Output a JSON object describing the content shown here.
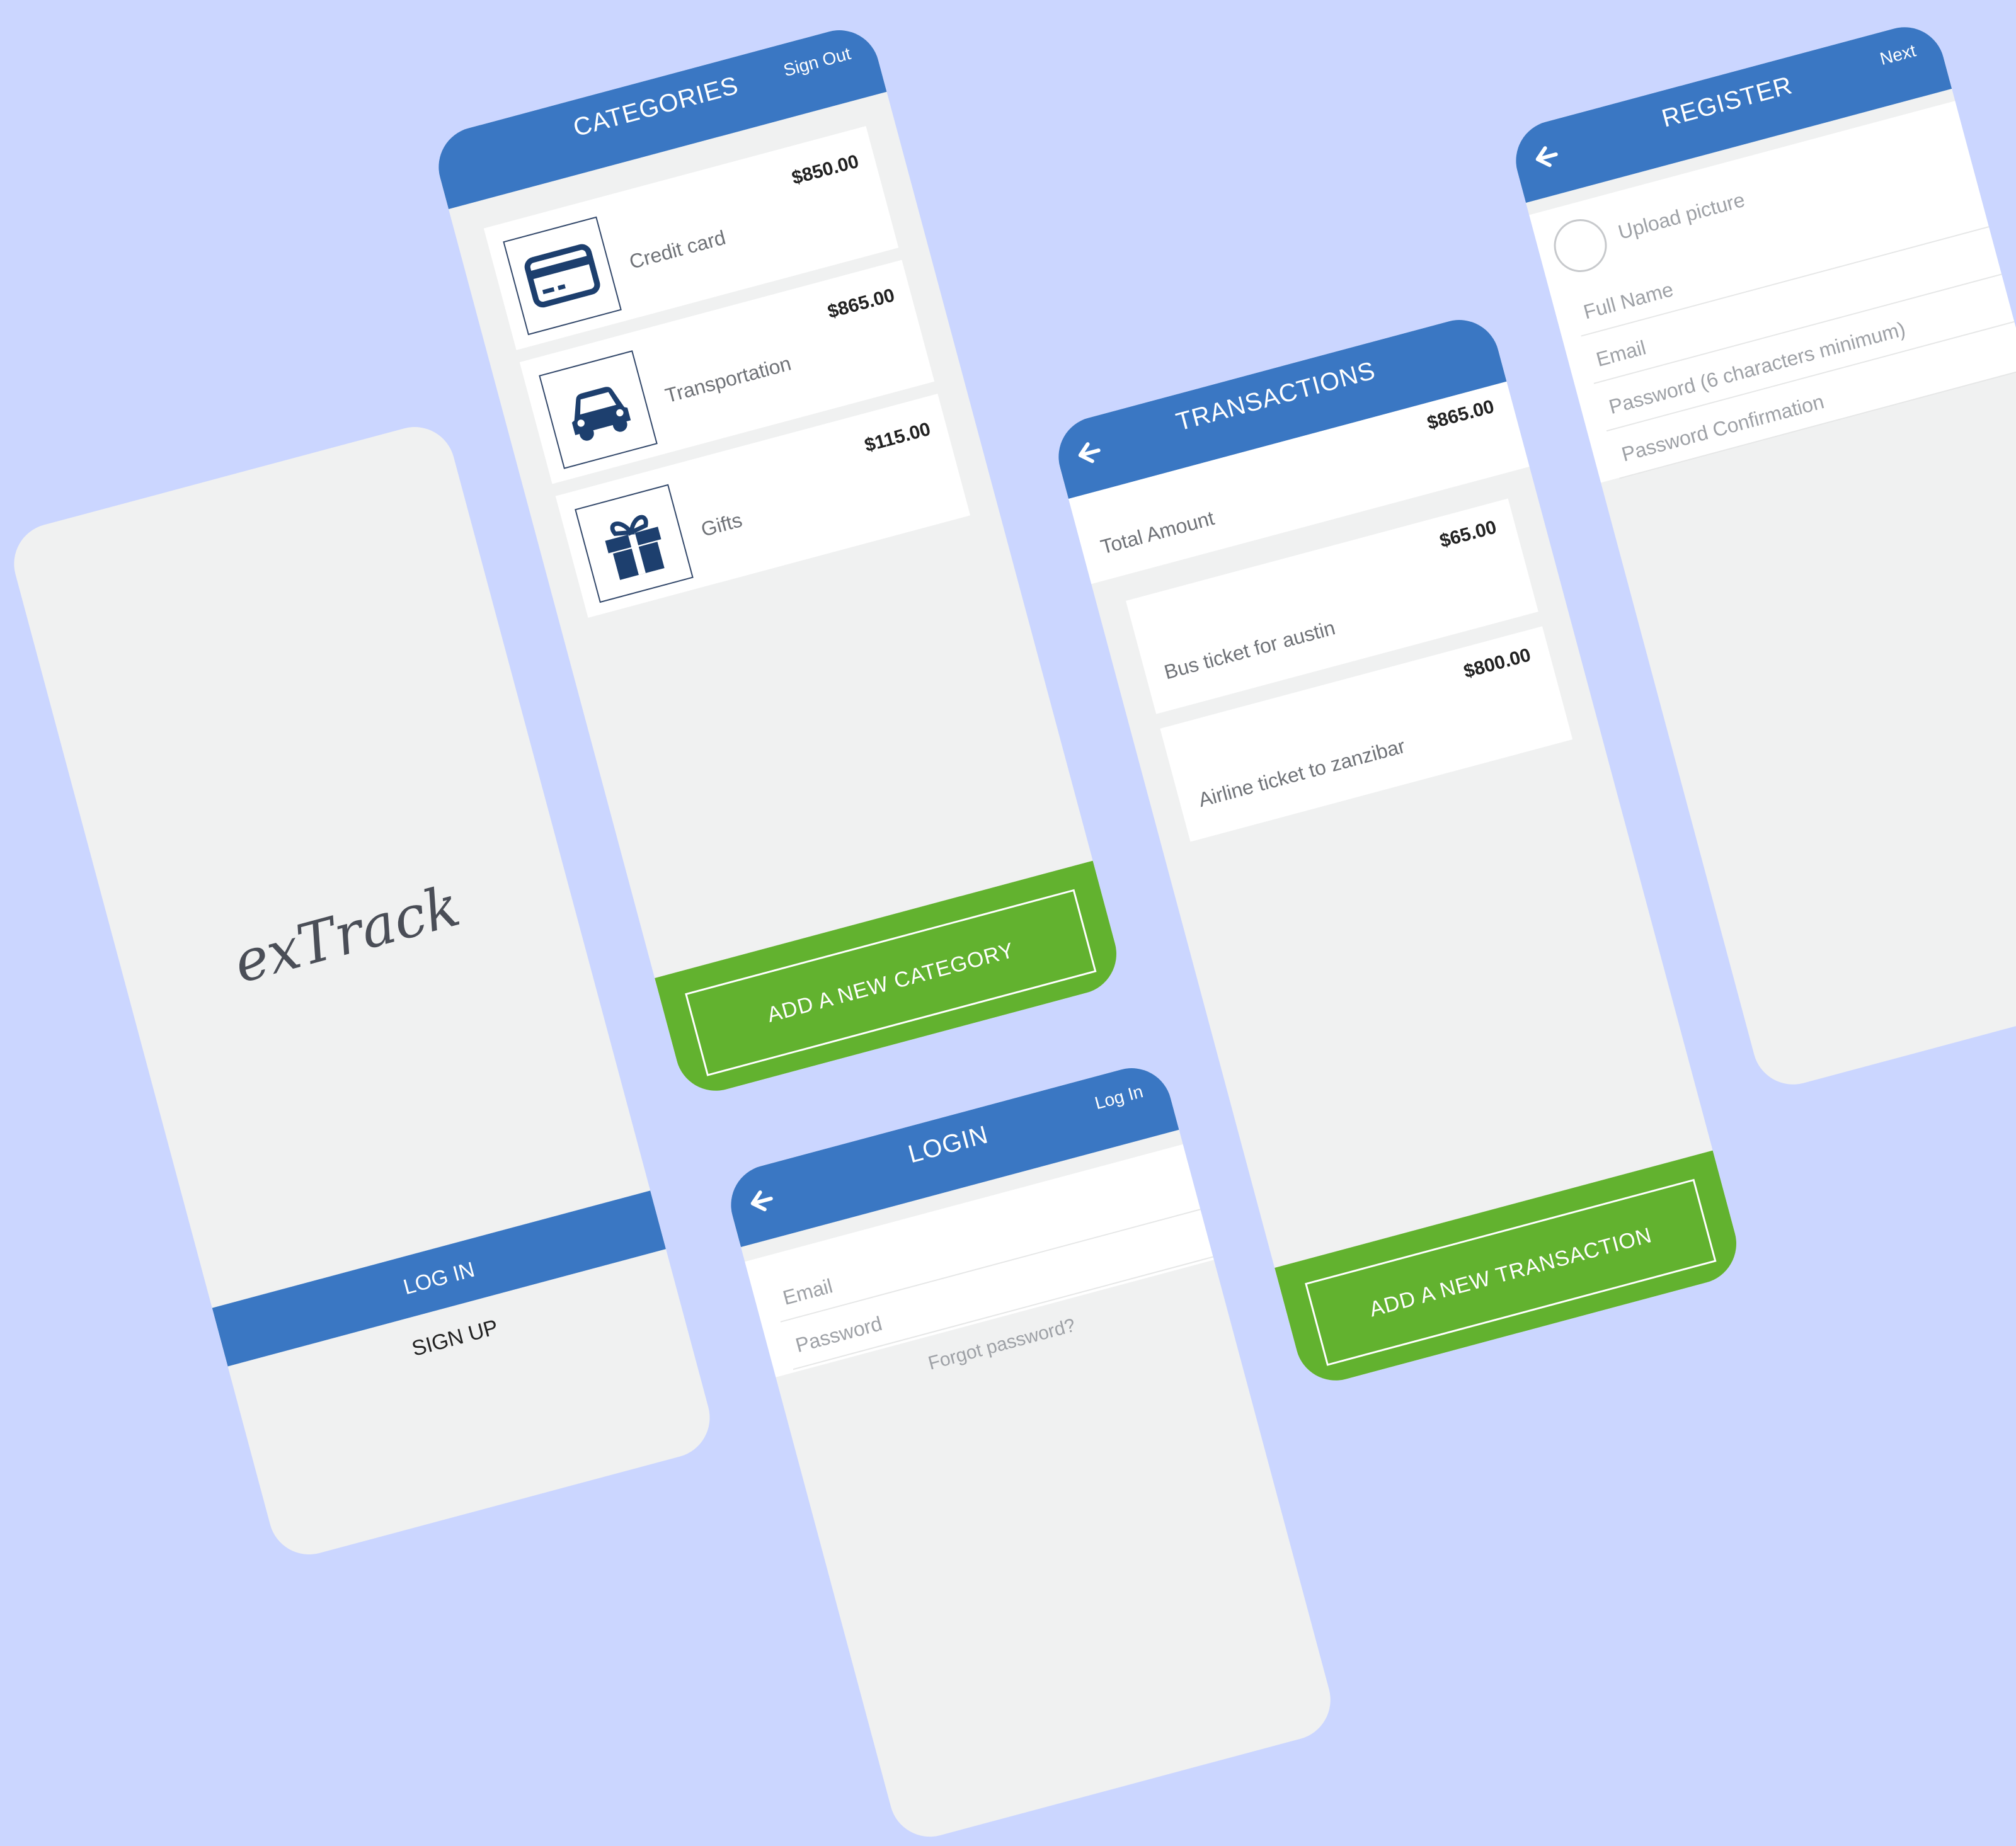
{
  "splash": {
    "logo_text": "exTrack",
    "login_label": "LOG IN",
    "signup_label": "SIGN UP"
  },
  "categories_screen": {
    "title": "CATEGORIES",
    "action_label": "Sign Out",
    "items": [
      {
        "label": "Credit card",
        "amount": "$850.00",
        "icon": "credit-card-icon"
      },
      {
        "label": "Transportation",
        "amount": "$865.00",
        "icon": "car-icon"
      },
      {
        "label": "Gifts",
        "amount": "$115.00",
        "icon": "gift-icon"
      }
    ],
    "add_button_label": "ADD A NEW CATEGORY"
  },
  "transactions_screen": {
    "title": "TRANSACTIONS",
    "total_label": "Total Amount",
    "total_amount": "$865.00",
    "items": [
      {
        "label": "Bus ticket for austin",
        "amount": "$65.00"
      },
      {
        "label": "Airline ticket to zanzibar",
        "amount": "$800.00"
      }
    ],
    "add_button_label": "ADD A NEW TRANSACTION"
  },
  "login_screen": {
    "title": "LOGIN",
    "action_label": "Log In",
    "email_placeholder": "Email",
    "password_placeholder": "Password",
    "forgot_label": "Forgot password?"
  },
  "register_screen": {
    "title": "REGISTER",
    "action_label": "Next",
    "upload_label": "Upload picture",
    "fullname_placeholder": "Full Name",
    "email_placeholder": "Email",
    "password_placeholder": "Password (6 characters minimum)",
    "password_confirm_placeholder": "Password Confirmation"
  },
  "colors": {
    "background": "#cbd6ff",
    "header_blue": "#3a77c3",
    "accent_green": "#62b22f",
    "icon_navy": "#1d3f6e",
    "screen_gray": "#f0f1f1"
  }
}
